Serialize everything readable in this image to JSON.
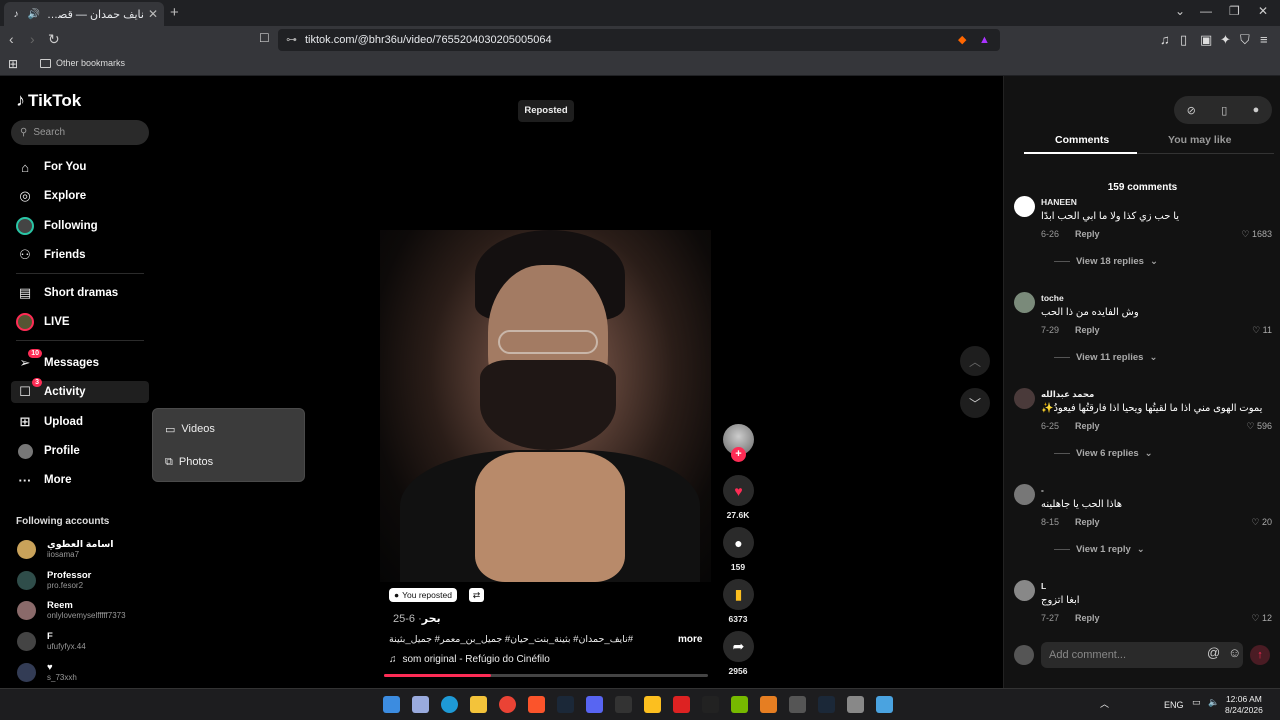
{
  "browser": {
    "tab_title": "نايف حمدان — قصص وتصمي",
    "url": "tiktok.com/@bhr36u/video/7655204030205005064",
    "bookmark_folder": "Other bookmarks"
  },
  "sidebar": {
    "logo": "TikTok",
    "search_placeholder": "Search",
    "items": [
      {
        "label": "For You",
        "icon": "home-icon"
      },
      {
        "label": "Explore",
        "icon": "compass-icon"
      },
      {
        "label": "Following",
        "icon": "following-avatar-icon"
      },
      {
        "label": "Friends",
        "icon": "friends-icon"
      },
      {
        "label": "Short dramas",
        "icon": "film-icon"
      },
      {
        "label": "LIVE",
        "icon": "live-icon"
      },
      {
        "label": "Messages",
        "icon": "send-icon",
        "badge": "10"
      },
      {
        "label": "Activity",
        "icon": "inbox-icon",
        "badge": "3"
      },
      {
        "label": "Upload",
        "icon": "plus-square-icon"
      },
      {
        "label": "Profile",
        "icon": "profile-avatar-icon"
      },
      {
        "label": "More",
        "icon": "more-icon"
      }
    ],
    "following_header": "Following accounts",
    "accounts": [
      {
        "name": "اسامة العطوي",
        "handle": "iiosama7"
      },
      {
        "name": "Professor",
        "handle": "pro.fesor2"
      },
      {
        "name": "Reem",
        "handle": "onlylovemyselfffff7373"
      },
      {
        "name": "F",
        "handle": "ufufyfyx.44"
      },
      {
        "name": "♥",
        "handle": "s_73xxh"
      }
    ]
  },
  "upload_menu": {
    "videos": "Videos",
    "photos": "Photos"
  },
  "video": {
    "reposted_label": "Reposted",
    "you_reposted": "You reposted",
    "author": "بحر",
    "date": "· 6-25",
    "description": "#نايف_حمدان# بثينة_بنت_حيان# جميل_بن_معمر# جميل_بثينة",
    "more": "more",
    "music": "som original - Refúgio do Cinéfilo",
    "progress": 0.33,
    "likes": "27.6K",
    "comments": "159",
    "saves": "6373",
    "shares": "2956"
  },
  "comments_panel": {
    "tab_comments": "Comments",
    "tab_you_may_like": "You may like",
    "count": "159 comments",
    "items": [
      {
        "user": "HANEEN",
        "text": "يا حب زي كذا ولا ما ابي الحب ابدًا",
        "date": "6-26",
        "reply": "Reply",
        "likes": "1683",
        "view_replies": "View 18 replies"
      },
      {
        "user": "toche",
        "text": "وش الفايده من ذا الحب",
        "date": "7-29",
        "reply": "Reply",
        "likes": "11",
        "view_replies": "View 11 replies"
      },
      {
        "user": "محمد عبدالله",
        "text": "يموت الهوى مني اذا ما لقيتُها ويحيا اذا فارقتُها فيعودُ✨",
        "date": "6-25",
        "reply": "Reply",
        "likes": "596",
        "view_replies": "View 6 replies"
      },
      {
        "user": "-",
        "text": "هاذا الحب يا جاهلينه",
        "date": "8-15",
        "reply": "Reply",
        "likes": "20",
        "view_replies": "View 1 reply"
      },
      {
        "user": "L",
        "text": "ابغا اتزوج",
        "date": "7-27",
        "reply": "Reply",
        "likes": "12",
        "view_replies": ""
      }
    ],
    "add_placeholder": "Add comment..."
  },
  "taskbar": {
    "lang": "ENG",
    "time": "12:06 AM",
    "date": "8/24/2026"
  },
  "colors": {
    "accent": "#fe2c55",
    "background": "#000000",
    "panel": "#121212"
  }
}
